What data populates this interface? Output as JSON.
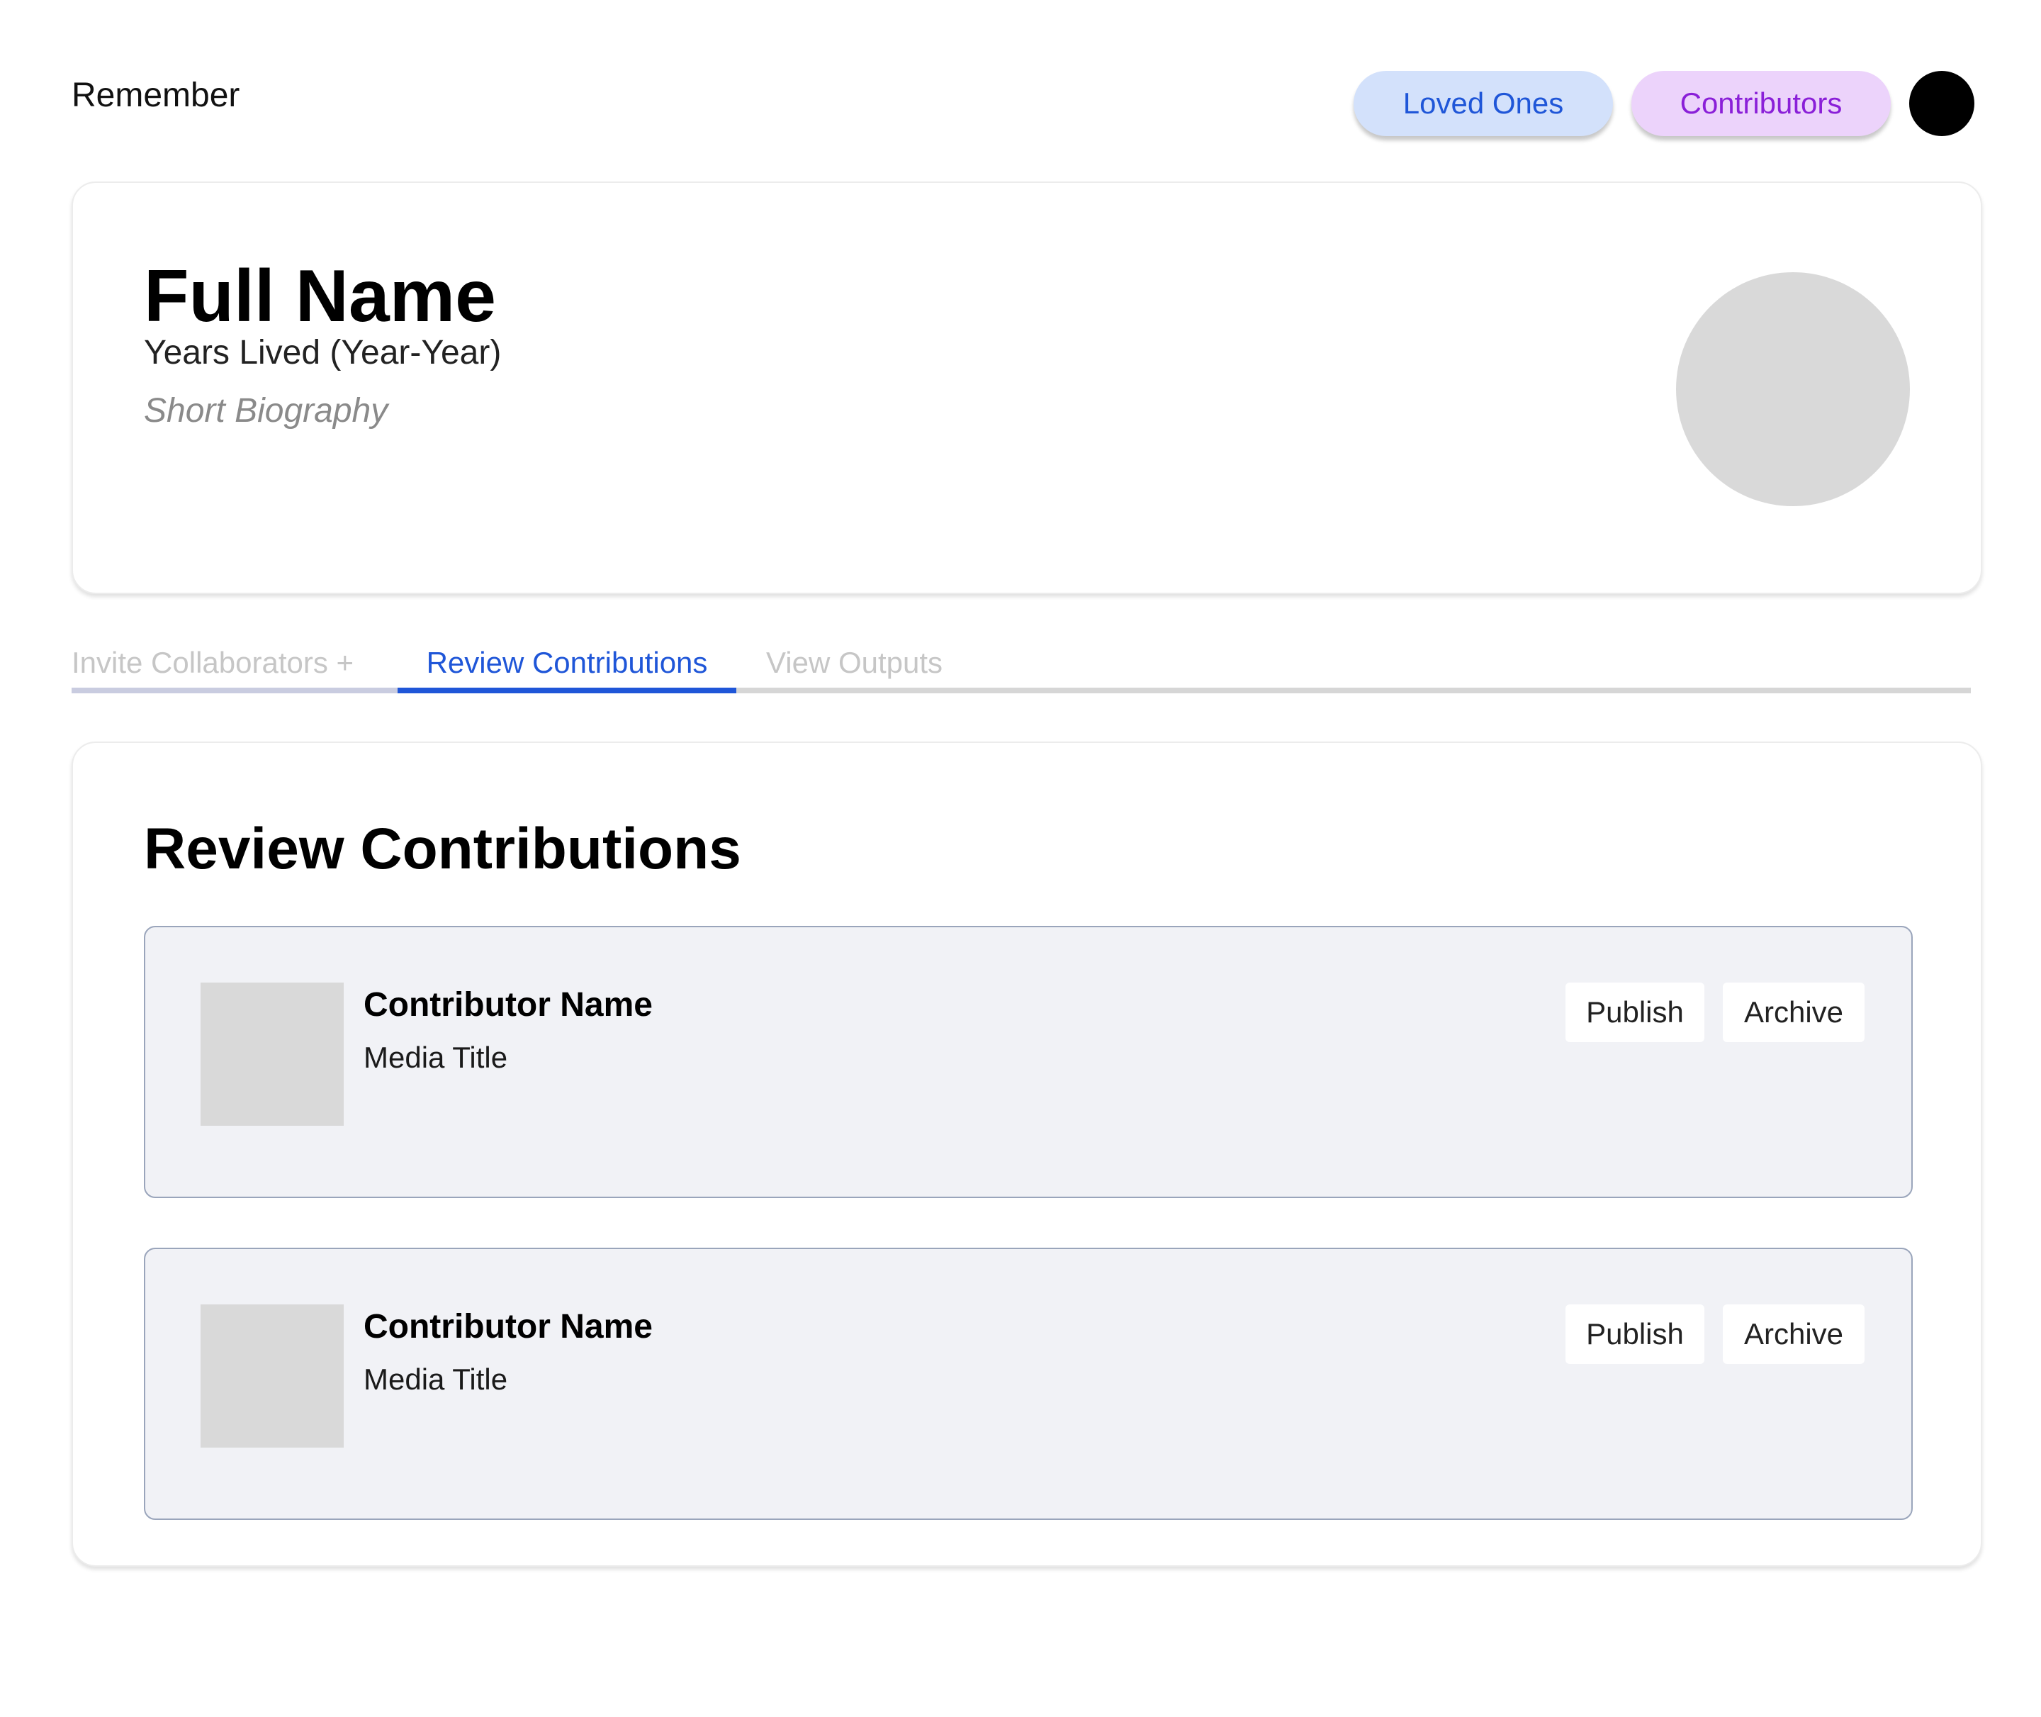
{
  "header": {
    "brand": "Remember",
    "nav": {
      "loved_ones": "Loved Ones",
      "contributors": "Contributors"
    }
  },
  "profile": {
    "full_name": "Full Name",
    "years": "Years Lived (Year-Year)",
    "bio": "Short Biography"
  },
  "tabs": [
    {
      "label": "Invite Collaborators +",
      "active": false
    },
    {
      "label": "Review Contributions",
      "active": true
    },
    {
      "label": "View Outputs",
      "active": false
    }
  ],
  "review": {
    "title": "Review Contributions",
    "items": [
      {
        "contributor": "Contributor Name",
        "media_title": "Media Title",
        "publish_label": "Publish",
        "archive_label": "Archive"
      },
      {
        "contributor": "Contributor Name",
        "media_title": "Media Title",
        "publish_label": "Publish",
        "archive_label": "Archive"
      }
    ]
  },
  "colors": {
    "accent_blue": "#1f56d8",
    "accent_purple": "#8a1fd8",
    "pill_blue_bg": "#d3e1fb",
    "pill_purple_bg": "#ecd3fb",
    "placeholder_gray": "#d9d9d9",
    "item_bg": "#f1f2f6"
  }
}
